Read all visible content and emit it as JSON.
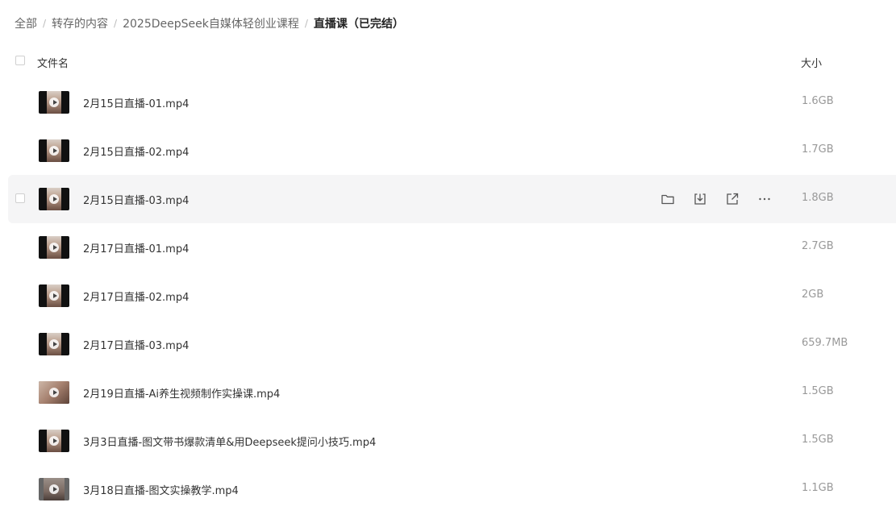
{
  "breadcrumb": [
    {
      "label": "全部",
      "current": false
    },
    {
      "label": "转存的内容",
      "current": false
    },
    {
      "label": "2025DeepSeek自媒体轻创业课程",
      "current": false
    },
    {
      "label": "直播课（已完结）",
      "current": true
    }
  ],
  "breadcrumb_separator": "/",
  "header": {
    "name_label": "文件名",
    "size_label": "大小"
  },
  "row_actions": [
    "folder-icon",
    "download-icon",
    "share-icon",
    "more-icon"
  ],
  "files": [
    {
      "name": "2月15日直播-01.mp4",
      "size": "1.6GB",
      "thumb": "portrait",
      "hover": false
    },
    {
      "name": "2月15日直播-02.mp4",
      "size": "1.7GB",
      "thumb": "portrait",
      "hover": false
    },
    {
      "name": "2月15日直播-03.mp4",
      "size": "1.8GB",
      "thumb": "portrait",
      "hover": true
    },
    {
      "name": "2月17日直播-01.mp4",
      "size": "2.7GB",
      "thumb": "portrait",
      "hover": false
    },
    {
      "name": "2月17日直播-02.mp4",
      "size": "2GB",
      "thumb": "portrait",
      "hover": false
    },
    {
      "name": "2月17日直播-03.mp4",
      "size": "659.7MB",
      "thumb": "portrait",
      "hover": false
    },
    {
      "name": "2月19日直播-Ai养生视频制作实操课.mp4",
      "size": "1.5GB",
      "thumb": "wide",
      "hover": false
    },
    {
      "name": "3月3日直播-图文带书爆款清单&用Deepseek提问小技巧.mp4",
      "size": "1.5GB",
      "thumb": "portrait",
      "hover": false
    },
    {
      "name": "3月18日直播-图文实操教学.mp4",
      "size": "1.1GB",
      "thumb": "gray",
      "hover": false
    }
  ]
}
